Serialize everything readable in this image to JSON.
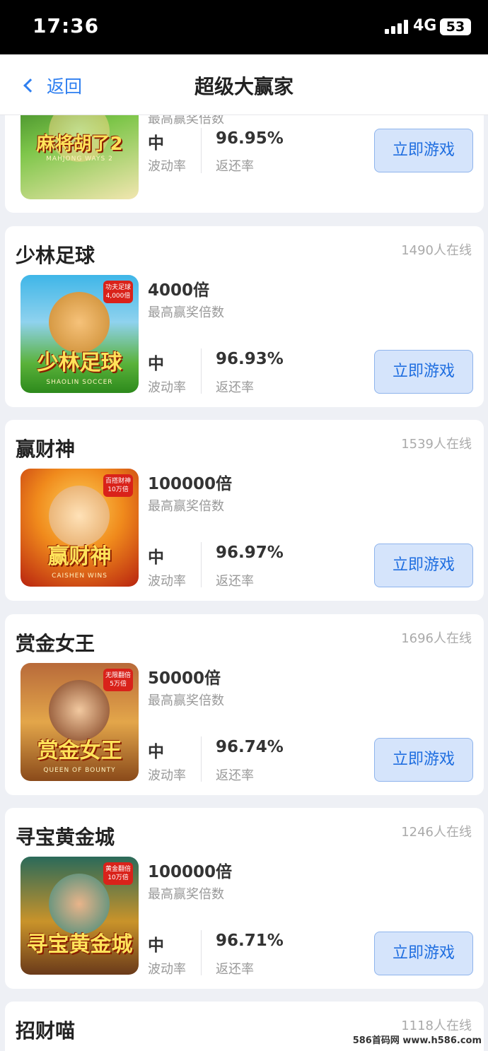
{
  "status_bar": {
    "time": "17:36",
    "network": "4G",
    "battery": "53"
  },
  "nav": {
    "back_label": "返回",
    "title": "超级大赢家"
  },
  "colors": {
    "accent": "#2f7ff0",
    "button_bg": "#d5e4fb"
  },
  "labels": {
    "max_multiplier": "最高赢奖倍数",
    "volatility": "波动率",
    "rtp": "返还率",
    "play": "立即游戏"
  },
  "games": [
    {
      "name": "",
      "online": "",
      "thumb_text": "麻将胡了2",
      "thumb_sub": "MAHJONG WAYS 2",
      "badge": "",
      "multiplier": "",
      "volatility": "中",
      "rtp": "96.95%"
    },
    {
      "name": "少林足球",
      "online": "1490人在线",
      "thumb_text": "少林足球",
      "thumb_sub": "SHAOLIN SOCCER",
      "badge": "功夫足球 4,000倍",
      "multiplier": "4000倍",
      "volatility": "中",
      "rtp": "96.93%"
    },
    {
      "name": "赢财神",
      "online": "1539人在线",
      "thumb_text": "赢财神",
      "thumb_sub": "CAISHEN WINS",
      "badge": "百搭财神 10万倍",
      "multiplier": "100000倍",
      "volatility": "中",
      "rtp": "96.97%"
    },
    {
      "name": "赏金女王",
      "online": "1696人在线",
      "thumb_text": "赏金女王",
      "thumb_sub": "QUEEN OF BOUNTY",
      "badge": "无限翻倍 5万倍",
      "multiplier": "50000倍",
      "volatility": "中",
      "rtp": "96.74%"
    },
    {
      "name": "寻宝黄金城",
      "online": "1246人在线",
      "thumb_text": "寻宝黄金城",
      "thumb_sub": "",
      "badge": "黄金翻倍 10万倍",
      "multiplier": "100000倍",
      "volatility": "中",
      "rtp": "96.71%"
    },
    {
      "name": "招财喵",
      "online": "1118人在线"
    }
  ],
  "watermark": "586首码网 www.h586.com"
}
